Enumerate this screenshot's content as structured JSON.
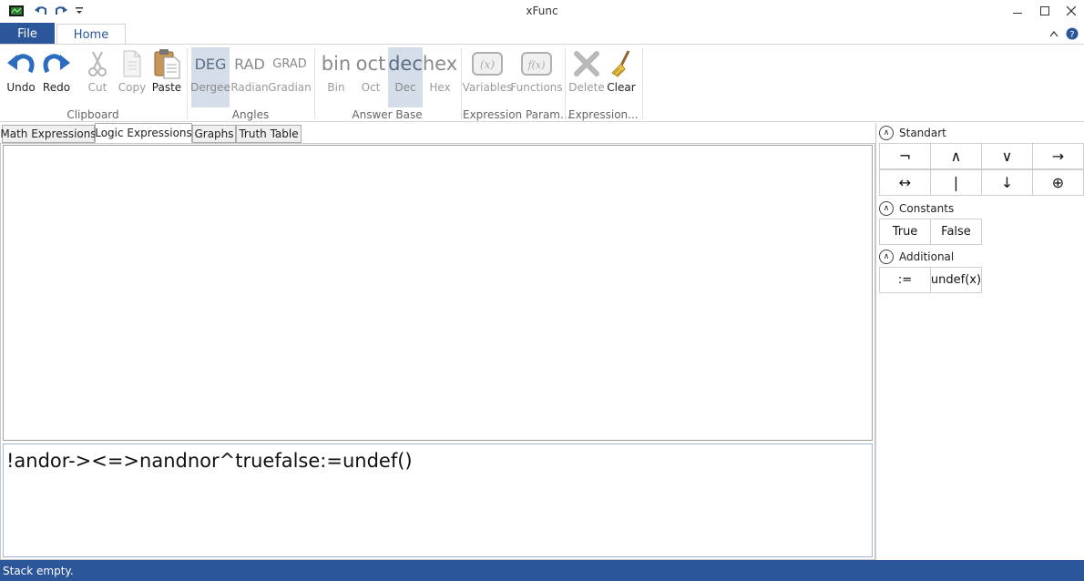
{
  "window": {
    "title": "xFunc"
  },
  "ribbon_tabs": {
    "file": "File",
    "home": "Home"
  },
  "clipboard": {
    "undo": "Undo",
    "redo": "Redo",
    "cut": "Cut",
    "copy": "Copy",
    "paste": "Paste",
    "group": "Clipboard"
  },
  "angles": {
    "deg_big": "DEG",
    "deg": "Dergee",
    "rad_big": "RAD",
    "rad": "Radian",
    "grad_big": "GRAD",
    "grad": "Gradian",
    "group": "Angles"
  },
  "base": {
    "bin_big": "bin",
    "bin": "Bin",
    "oct_big": "oct",
    "oct": "Oct",
    "dec_big": "dec",
    "dec": "Dec",
    "hex_big": "hex",
    "hex": "Hex",
    "group": "Answer Base"
  },
  "params": {
    "variables": "Variables",
    "functions": "Functions",
    "group": "Expression Param..."
  },
  "expression": {
    "delete": "Delete",
    "clear": "Clear",
    "group": "Expression..."
  },
  "doc_tabs": [
    "Math Expressions",
    "Logic Expressions",
    "Graphs",
    "Truth Table"
  ],
  "input": {
    "value": "!andor->&lt;=>nandnor^truefalse:=undef()"
  },
  "panel": {
    "standart": {
      "title": "Standart",
      "keys": [
        "¬",
        "∧",
        "∨",
        "→",
        "↔",
        "|",
        "↓",
        "⊕"
      ]
    },
    "constants": {
      "title": "Constants",
      "keys": [
        "True",
        "False"
      ]
    },
    "additional": {
      "title": "Additional",
      "keys": [
        ":=",
        "undef(x)"
      ]
    }
  },
  "status": {
    "text": "Stack empty."
  },
  "colors": {
    "accent": "#2b579a",
    "selected": "#d5dde9"
  }
}
